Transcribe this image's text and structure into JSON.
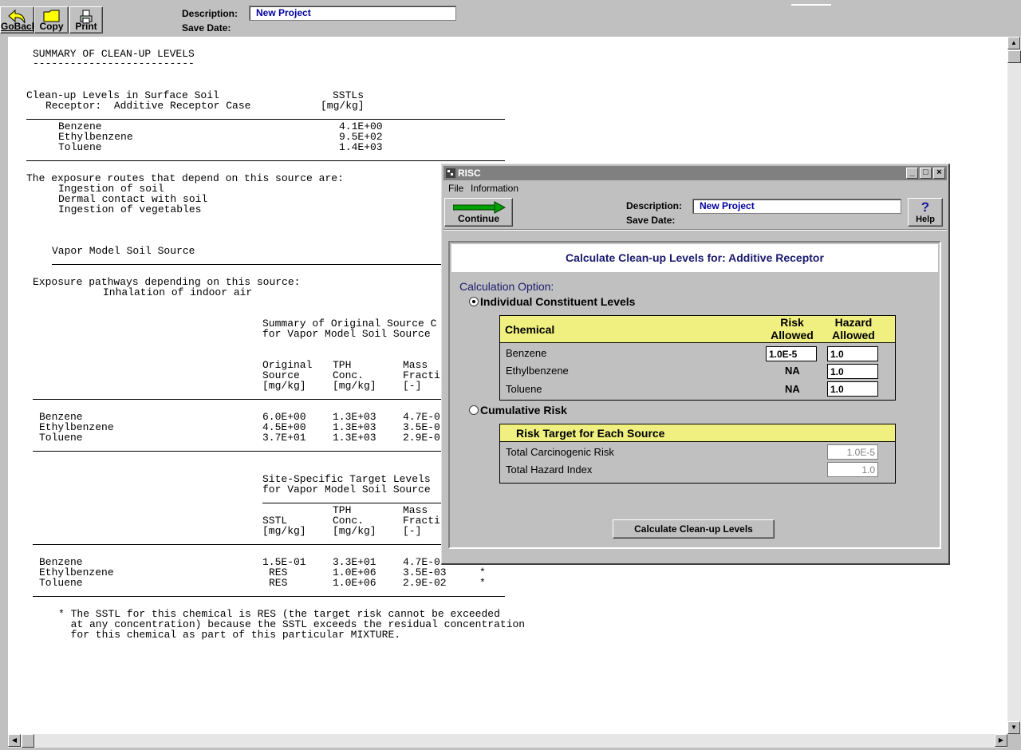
{
  "toolbar": {
    "goback_label": "GoBack",
    "copy_label": "Copy",
    "print_label": "Print",
    "description_label": "Description:",
    "description_value": "New Project",
    "save_date_label": "Save Date:"
  },
  "report": {
    "title": "SUMMARY OF CLEAN-UP LEVELS",
    "title_underline": "--------------------------",
    "section1_heading": "Clean-up Levels in Surface Soil",
    "section1_receptor": "Receptor:  Additive Receptor Case",
    "sstl_header": "SSTLs",
    "sstl_units": "[mg/kg]",
    "section1_rows": [
      {
        "chemical": "Benzene",
        "value": "4.1E+00"
      },
      {
        "chemical": "Ethylbenzene",
        "value": "9.5E+02"
      },
      {
        "chemical": "Toluene",
        "value": "1.4E+03"
      }
    ],
    "exposure_intro": "The exposure routes that depend on this source are:",
    "exposure_routes": [
      "Ingestion of soil",
      "Dermal contact with soil",
      "Ingestion of vegetables"
    ],
    "vapor_heading": "Vapor Model Soil Source",
    "pathways_intro": "Exposure pathways depending on this source:",
    "pathway": "Inhalation of indoor air",
    "summary_original_1": "Summary of Original Source C",
    "summary_original_2": "for Vapor Model Soil Source",
    "orig_headers": {
      "c1": [
        "Original",
        "Source",
        "[mg/kg]"
      ],
      "c2": [
        "TPH",
        "Conc.",
        "[mg/kg]"
      ],
      "c3": [
        "Mass",
        "Fracti",
        "[-]"
      ]
    },
    "orig_rows": [
      {
        "chemical": "Benzene",
        "source": "6.0E+00",
        "tph": "1.3E+03",
        "mass": "4.7E-0"
      },
      {
        "chemical": "Ethylbenzene",
        "source": "4.5E+00",
        "tph": "1.3E+03",
        "mass": "3.5E-0"
      },
      {
        "chemical": "Toluene",
        "source": "3.7E+01",
        "tph": "1.3E+03",
        "mass": "2.9E-0"
      }
    ],
    "target_1": "Site-Specific Target Levels",
    "target_2": "for Vapor Model Soil Source",
    "target_headers": {
      "c1": [
        "",
        "SSTL",
        "[mg/kg]"
      ],
      "c2": [
        "TPH",
        "Conc.",
        "[mg/kg]"
      ],
      "c3": [
        "Mass",
        "Fracti",
        "[-]"
      ]
    },
    "target_rows": [
      {
        "chemical": "Benzene",
        "sstl": "1.5E-01",
        "tph": "3.3E+01",
        "mass": "4.7E-0",
        "flag": ""
      },
      {
        "chemical": "Ethylbenzene",
        "sstl": "RES",
        "tph": "1.0E+06",
        "mass": "3.5E-03",
        "flag": "*"
      },
      {
        "chemical": "Toluene",
        "sstl": "RES",
        "tph": "1.0E+06",
        "mass": "2.9E-02",
        "flag": "*"
      }
    ],
    "footnote": [
      "* The SSTL for this chemical is RES (the target risk cannot be exceeded",
      "  at any concentration) because the SSTL exceeds the residual concentration",
      "  for this chemical as part of this particular MIXTURE."
    ]
  },
  "dialog": {
    "title": "RISC",
    "menu": [
      "File",
      "Information"
    ],
    "continue_label": "Continue",
    "help_label": "Help",
    "description_label": "Description:",
    "description_value": "New Project",
    "save_date_label": "Save Date:",
    "header": "Calculate Clean-up Levels for:  Additive Receptor",
    "calc_option_label": "Calculation Option:",
    "option_individual": "Individual Constituent Levels",
    "option_cumulative": "Cumulative Risk",
    "selected_option": "Individual Constituent Levels",
    "table": {
      "col_chemical": "Chemical",
      "col_risk": [
        "Risk",
        "Allowed"
      ],
      "col_hazard": [
        "Hazard",
        "Allowed"
      ],
      "rows": [
        {
          "chemical": "Benzene",
          "risk": "1.0E-5",
          "hazard": "1.0",
          "risk_editable": true
        },
        {
          "chemical": "Ethylbenzene",
          "risk": "NA",
          "hazard": "1.0",
          "risk_editable": false
        },
        {
          "chemical": "Toluene",
          "risk": "NA",
          "hazard": "1.0",
          "risk_editable": false
        }
      ]
    },
    "risk_target": {
      "title": "Risk Target for Each Source",
      "rows": [
        {
          "label": "Total Carcinogenic Risk",
          "value": "1.0E-5"
        },
        {
          "label": "Total Hazard Index",
          "value": "1.0"
        }
      ]
    },
    "calculate_label": "Calculate Clean-up Levels",
    "colors": {
      "accent": "#1a1a6e",
      "header_yellow": "#f0f080",
      "desc_text": "#0000a0"
    }
  }
}
